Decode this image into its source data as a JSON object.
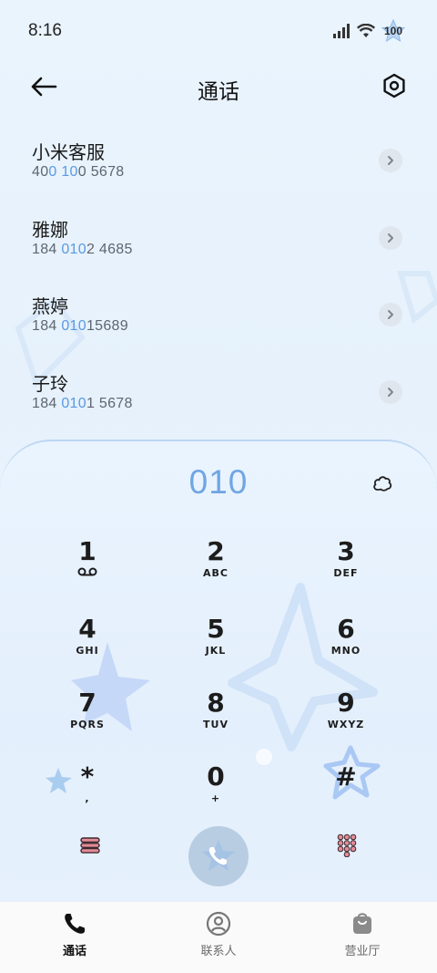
{
  "status_bar": {
    "time": "8:16",
    "battery": "100",
    "icons": [
      "signal-icon",
      "wifi-icon",
      "battery-icon"
    ]
  },
  "header": {
    "title": "通话",
    "back_icon": "arrow-left-icon",
    "settings_icon": "hexagon-settings-icon"
  },
  "contacts": [
    {
      "name": "小米客服",
      "number_parts": [
        "40",
        "0",
        " ",
        "10",
        "0 5678"
      ]
    },
    {
      "name": "雅娜",
      "number_parts": [
        "184 ",
        "010",
        "2 4685"
      ]
    },
    {
      "name": "燕婷",
      "number_parts": [
        "184 ",
        "010",
        "15689"
      ]
    },
    {
      "name": "子玲",
      "number_parts": [
        "184 ",
        "010",
        "1 5678"
      ]
    }
  ],
  "dialer": {
    "input": "010",
    "keys": [
      {
        "digit": "1",
        "letters": ""
      },
      {
        "digit": "2",
        "letters": "ABC"
      },
      {
        "digit": "3",
        "letters": "DEF"
      },
      {
        "digit": "4",
        "letters": "GHI"
      },
      {
        "digit": "5",
        "letters": "JKL"
      },
      {
        "digit": "6",
        "letters": "MNO"
      },
      {
        "digit": "7",
        "letters": "PQRS"
      },
      {
        "digit": "8",
        "letters": "TUV"
      },
      {
        "digit": "9",
        "letters": "WXYZ"
      },
      {
        "digit": "*",
        "letters": ","
      },
      {
        "digit": "0",
        "letters": "+"
      },
      {
        "digit": "#",
        "letters": ""
      }
    ]
  },
  "bottom_nav": {
    "items": [
      {
        "label": "通话",
        "icon": "phone-icon",
        "active": true
      },
      {
        "label": "联系人",
        "icon": "person-icon",
        "active": false
      },
      {
        "label": "营业厅",
        "icon": "bag-icon",
        "active": false
      }
    ]
  },
  "colors": {
    "accent": "#6fa6e3",
    "highlight_number": "#5a9ae0",
    "call_button": "#b8cde2",
    "menu_icon": "#d4707e"
  }
}
